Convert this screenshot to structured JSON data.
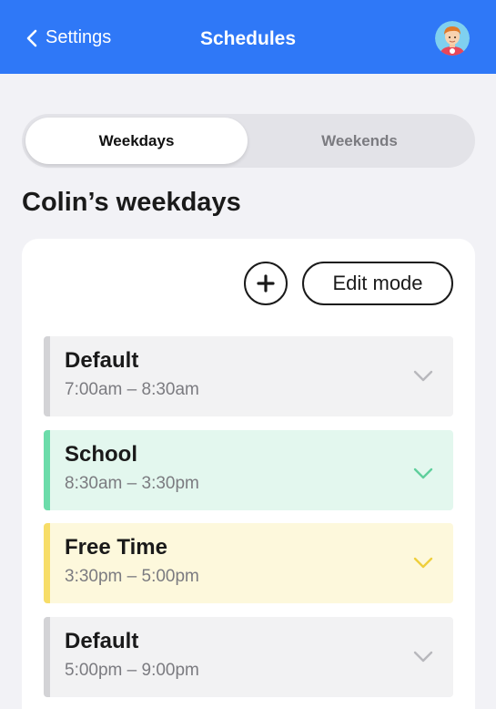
{
  "header": {
    "back_label": "Settings",
    "title": "Schedules",
    "avatar_icon": "child-avatar-icon"
  },
  "tabs": [
    {
      "label": "Weekdays",
      "selected": true
    },
    {
      "label": "Weekends",
      "selected": false
    }
  ],
  "section_title": "Colin’s weekdays",
  "toolbar": {
    "add_icon": "plus-icon",
    "edit_label": "Edit mode"
  },
  "schedule": [
    {
      "name": "Default",
      "time": "7:00am – 8:30am",
      "color": "#d3d3d6",
      "bg": "#f2f2f3",
      "chevron_color": "#b8b8bc"
    },
    {
      "name": "School",
      "time": "8:30am – 3:30pm",
      "color": "#6cdcaa",
      "bg": "#e3f7ee",
      "chevron_color": "#5fcf9c"
    },
    {
      "name": "Free Time",
      "time": "3:30pm – 5:00pm",
      "color": "#f7dd68",
      "bg": "#fdf8dc",
      "chevron_color": "#efcf3c"
    },
    {
      "name": "Default",
      "time": "5:00pm – 9:00pm",
      "color": "#d3d3d6",
      "bg": "#f2f2f3",
      "chevron_color": "#b8b8bc"
    }
  ]
}
